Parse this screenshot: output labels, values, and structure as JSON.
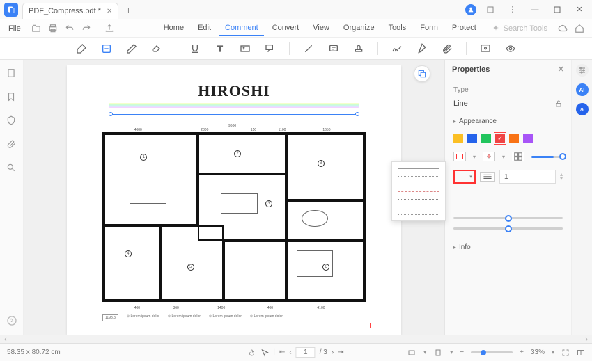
{
  "titlebar": {
    "tab_title": "PDF_Compress.pdf *"
  },
  "menu": {
    "file": "File",
    "tabs": [
      "Home",
      "Edit",
      "Comment",
      "Convert",
      "View",
      "Organize",
      "Tools",
      "Form",
      "Protect"
    ],
    "active_tab": "Comment",
    "search_placeholder": "Search Tools"
  },
  "document": {
    "title": "HIROSHI"
  },
  "properties": {
    "panel_title": "Properties",
    "type_label": "Type",
    "type_value": "Line",
    "appearance_label": "Appearance",
    "colors": [
      "#fbbf24",
      "#2563eb",
      "#22c55e",
      "#ef4444",
      "#f97316",
      "#a855f7"
    ],
    "selected_color_index": 3,
    "thickness_value": "1",
    "info_label": "Info"
  },
  "status": {
    "dimensions": "58.35 x 80.72 cm",
    "page_current": "1",
    "page_total": "/ 3",
    "zoom": "33%"
  }
}
